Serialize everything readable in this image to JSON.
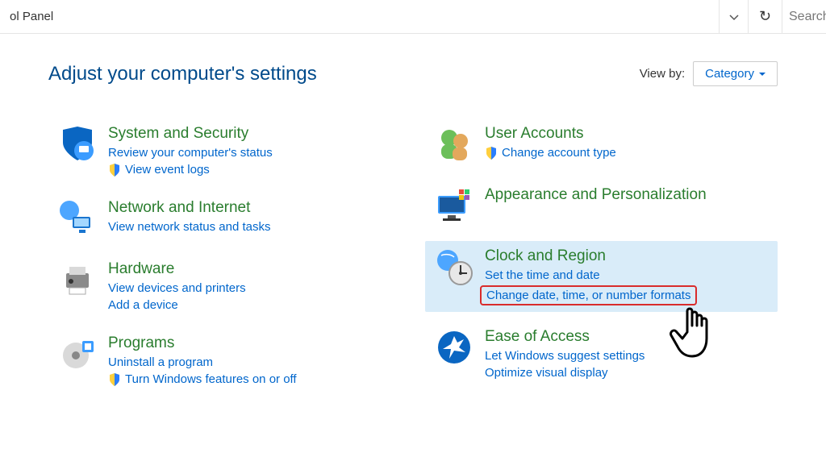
{
  "toolbar": {
    "breadcrumb_text": "ol Panel",
    "search_placeholder": "Search"
  },
  "header": {
    "title": "Adjust your computer's settings",
    "viewby_label": "View by:",
    "viewby_value": "Category"
  },
  "left_col": [
    {
      "id": "system-security",
      "title": "System and Security",
      "links": [
        {
          "text": "Review your computer's status",
          "shield": false
        },
        {
          "text": "View event logs",
          "shield": true
        }
      ]
    },
    {
      "id": "network-internet",
      "title": "Network and Internet",
      "links": [
        {
          "text": "View network status and tasks",
          "shield": false
        }
      ]
    },
    {
      "id": "hardware",
      "title": "Hardware",
      "links": [
        {
          "text": "View devices and printers",
          "shield": false
        },
        {
          "text": "Add a device",
          "shield": false
        }
      ]
    },
    {
      "id": "programs",
      "title": "Programs",
      "links": [
        {
          "text": "Uninstall a program",
          "shield": false
        },
        {
          "text": "Turn Windows features on or off",
          "shield": true
        }
      ]
    }
  ],
  "right_col": [
    {
      "id": "user-accounts",
      "title": "User Accounts",
      "links": [
        {
          "text": "Change account type",
          "shield": true
        }
      ]
    },
    {
      "id": "appearance",
      "title": "Appearance and Personalization",
      "links": []
    },
    {
      "id": "clock-region",
      "title": "Clock and Region",
      "highlighted": true,
      "links": [
        {
          "text": "Set the time and date",
          "shield": false
        },
        {
          "text": "Change date, time, or number formats",
          "shield": false,
          "boxed": true
        }
      ]
    },
    {
      "id": "ease-access",
      "title": "Ease of Access",
      "links": [
        {
          "text": "Let Windows suggest settings",
          "shield": false
        },
        {
          "text": "Optimize visual display",
          "shield": false
        }
      ]
    }
  ]
}
